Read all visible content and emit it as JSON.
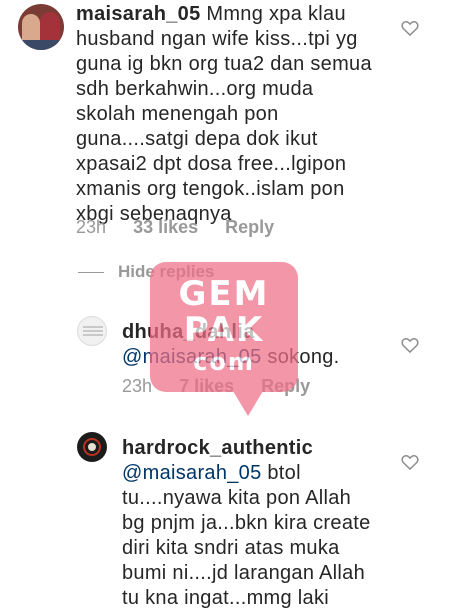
{
  "comments": [
    {
      "username": "maisarah_05",
      "text_lines": [
        "Mmng xpa klau",
        "husband ngan wife kiss...tpi yg",
        "guna ig bkn org tua2 dan semua",
        "sdh berkahwin...org muda",
        "skolah menengah pon",
        "guna....satgi depa dok ikut",
        "xpasai2 dpt dosa free...lgipon",
        "xmanis org tengok..islam pon",
        "xbgi sebenaqnya"
      ],
      "time": "23h",
      "likes": "33 likes",
      "reply": "Reply"
    }
  ],
  "hide_replies": "Hide replies",
  "replies": [
    {
      "username": "dhuha_dahlia",
      "mention": "@maisarah_05",
      "text": " sokong.",
      "time": "23h",
      "likes": "7 likes",
      "reply": "Reply"
    },
    {
      "username": "hardrock_authentic",
      "mention": "@maisarah_05",
      "text_first": " btol",
      "text_lines": [
        "tu....nyawa kita pon Allah",
        "bg pnjm ja...bkn kira create",
        "diri kita sndri atas muka",
        "bumi ni....jd larangan Allah",
        "tu kna ingat...mmg laki"
      ]
    }
  ],
  "watermark": {
    "line1": "GEM",
    "line2": "PAK",
    "line3": "com",
    "color": "#ef6f86"
  },
  "icons": {
    "like": "heart-outline-icon"
  }
}
